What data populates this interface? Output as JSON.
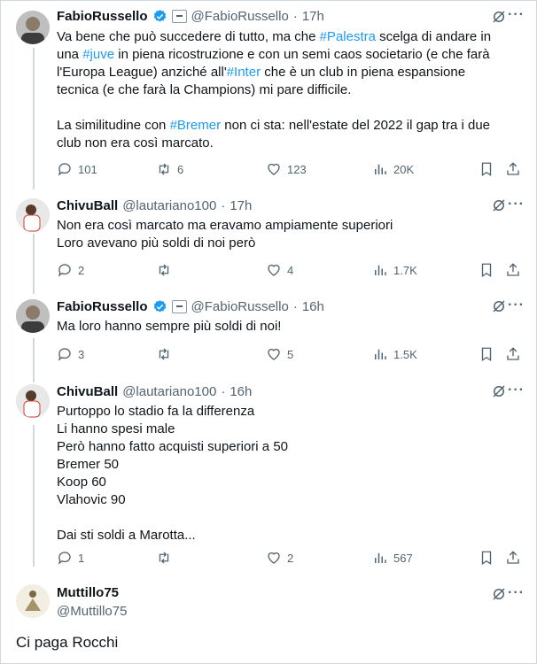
{
  "tweets": [
    {
      "name": "FabioRussello",
      "handle": "@FabioRussello",
      "time": "17h",
      "lines": [
        [
          "Va bene che può succedere di tutto, ma che ",
          "#Palestra",
          " scelga di andare in"
        ],
        [
          "una ",
          "#juve",
          " in piena ricostruzione e con un semi caos societario (e che farà"
        ],
        [
          "l'Europa League) anziché all'",
          "#Inter",
          " che è un club in piena espansione"
        ],
        [
          "tecnica (e che farà la Champions) mi pare difficile."
        ],
        [
          ""
        ],
        [
          "La similitudine con ",
          "#Bremer",
          " non ci sta: nell'estate del 2022 il gap tra i due"
        ],
        [
          "club non era così marcato."
        ]
      ],
      "replies": "101",
      "reposts": "6",
      "likes": "123",
      "views": "20K"
    },
    {
      "name": "ChivuBall",
      "handle": "@lautariano100",
      "time": "17h",
      "text": [
        "Non era così marcato ma eravamo ampiamente superiori",
        "Loro avevano più soldi di noi però"
      ],
      "replies": "2",
      "reposts": "",
      "likes": "4",
      "views": "1.7K"
    },
    {
      "name": "FabioRussello",
      "handle": "@FabioRussello",
      "time": "16h",
      "text": [
        "Ma loro hanno sempre più soldi di noi!"
      ],
      "replies": "3",
      "reposts": "",
      "likes": "5",
      "views": "1.5K"
    },
    {
      "name": "ChivuBall",
      "handle": "@lautariano100",
      "time": "16h",
      "text": [
        "Purtoppo lo stadio fa la differenza",
        "Li hanno spesi male",
        "Però hanno fatto acquisti superiori a 50",
        "Bremer 50",
        "Koop 60",
        "Vlahovic 90",
        "",
        "Dai sti soldi a Marotta..."
      ],
      "replies": "1",
      "reposts": "",
      "likes": "2",
      "views": "567"
    }
  ],
  "main_post": {
    "name": "Muttillo75",
    "handle": "@Muttillo75",
    "text": "Ci paga Rocchi"
  },
  "separator": "·",
  "more": "···",
  "colors": {
    "link": "#1d9bf0",
    "muted": "#536471",
    "verified": "#1d9bf0"
  },
  "icons": [
    "reply-icon",
    "repost-icon",
    "like-icon",
    "views-icon",
    "bookmark-icon",
    "share-icon",
    "grok-icon",
    "verified-icon",
    "more-icon"
  ]
}
